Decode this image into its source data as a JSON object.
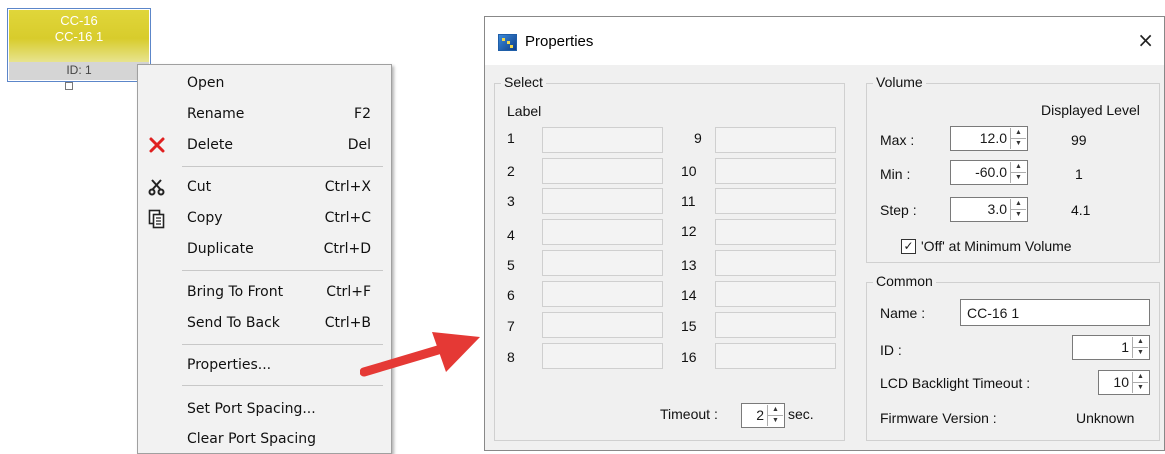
{
  "device": {
    "title_line1": "CC-16",
    "title_line2": "CC-16 1",
    "id_text": "ID: 1"
  },
  "context_menu": {
    "items": [
      {
        "label": "Open",
        "shortcut": "",
        "icon": ""
      },
      {
        "label": "Rename",
        "shortcut": "F2",
        "icon": ""
      },
      {
        "label": "Delete",
        "shortcut": "Del",
        "icon": "delete-x-icon"
      },
      {
        "label": "Cut",
        "shortcut": "Ctrl+X",
        "icon": "scissors-icon"
      },
      {
        "label": "Copy",
        "shortcut": "Ctrl+C",
        "icon": "copy-icon"
      },
      {
        "label": "Duplicate",
        "shortcut": "Ctrl+D",
        "icon": ""
      },
      {
        "label": "Bring To Front",
        "shortcut": "Ctrl+F",
        "icon": ""
      },
      {
        "label": "Send To Back",
        "shortcut": "Ctrl+B",
        "icon": ""
      },
      {
        "label": "Properties...",
        "shortcut": "",
        "icon": ""
      },
      {
        "label": "Set Port Spacing...",
        "shortcut": "",
        "icon": ""
      },
      {
        "label": "Clear Port Spacing",
        "shortcut": "",
        "icon": ""
      }
    ]
  },
  "colors": {
    "arrow": "#e53935",
    "device_accent": "#d8cc2c",
    "delete_icon": "#e02020"
  },
  "dialog": {
    "title": "Properties",
    "close_glyph": "×",
    "select": {
      "group_title": "Select",
      "label_header": "Label",
      "rows_left": [
        "1",
        "2",
        "3",
        "4",
        "5",
        "6",
        "7",
        "8"
      ],
      "rows_right": [
        "9",
        "10",
        "11",
        "12",
        "13",
        "14",
        "15",
        "16"
      ],
      "timeout_label": "Timeout :",
      "timeout_value": "2",
      "timeout_unit": "sec."
    },
    "volume": {
      "group_title": "Volume",
      "displayed_level_header": "Displayed Level",
      "max_label": "Max :",
      "max_value": "12.0",
      "max_level": "99",
      "min_label": "Min :",
      "min_value": "-60.0",
      "min_level": "1",
      "step_label": "Step :",
      "step_value": "3.0",
      "step_level": "4.1",
      "off_checkbox_label": "'Off' at Minimum Volume",
      "off_checked": true
    },
    "common": {
      "group_title": "Common",
      "name_label": "Name :",
      "name_value": "CC-16 1",
      "id_label": "ID :",
      "id_value": "1",
      "backlight_label": "LCD Backlight Timeout :",
      "backlight_value": "10",
      "firmware_label": "Firmware Version :",
      "firmware_value": "Unknown"
    }
  }
}
